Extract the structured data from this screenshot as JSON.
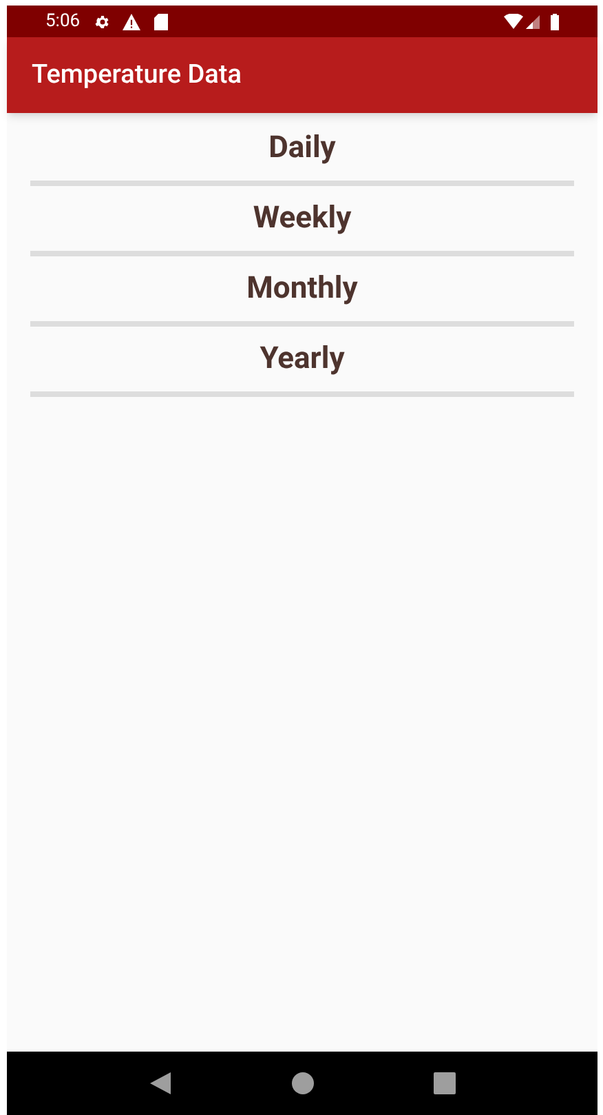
{
  "status_bar": {
    "time": "5:06"
  },
  "app_bar": {
    "title": "Temperature Data"
  },
  "list": {
    "items": [
      {
        "label": "Daily"
      },
      {
        "label": "Weekly"
      },
      {
        "label": "Monthly"
      },
      {
        "label": "Yearly"
      }
    ]
  }
}
